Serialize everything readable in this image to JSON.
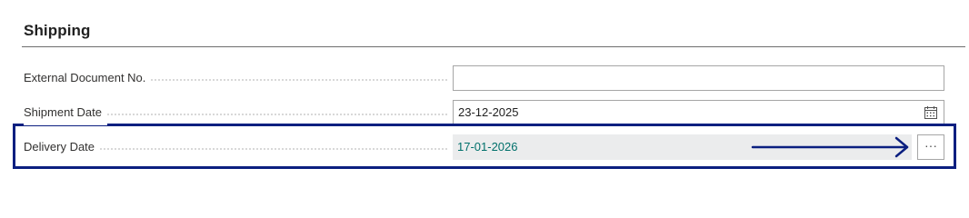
{
  "section": {
    "title": "Shipping"
  },
  "fields": {
    "external_document_no": {
      "label": "External Document No.",
      "value": ""
    },
    "shipment_date": {
      "label": "Shipment Date",
      "value": "23-12-2025",
      "icon": "calendar-icon"
    },
    "delivery_date": {
      "label": "Delivery Date",
      "value": "17-01-2026",
      "assist_button_label": "···"
    }
  },
  "annotation": {
    "highlight_color": "#0b1f80",
    "arrow_color": "#0b1f80"
  },
  "colors": {
    "delivery_value": "#00706b",
    "readonly_field_bg": "#ebeced"
  }
}
